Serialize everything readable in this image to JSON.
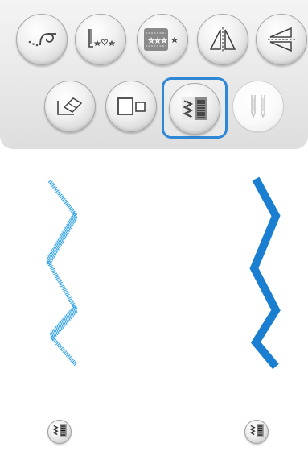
{
  "toolbar": {
    "row1": [
      {
        "name": "thread-cutter-icon"
      },
      {
        "name": "stitch-pattern-icon"
      },
      {
        "name": "decorative-stitch-icon"
      },
      {
        "name": "mirror-vertical-icon"
      },
      {
        "name": "mirror-horizontal-icon"
      }
    ],
    "row2": [
      {
        "name": "eraser-icon"
      },
      {
        "name": "stitch-size-icon"
      },
      {
        "name": "stitch-density-icon",
        "selected": true
      },
      {
        "name": "twin-needle-icon",
        "disabled": true
      }
    ]
  },
  "preview": {
    "left": {
      "style": "dense-zigzag",
      "icon": "stitch-density-icon"
    },
    "right": {
      "style": "satin-zigzag",
      "icon": "stitch-density-icon"
    }
  },
  "colors": {
    "accent": "#2f88d6",
    "stitch_light": "#3aa6e6",
    "stitch_dark": "#1a7fd0",
    "disabled": "#c4c4c4"
  }
}
